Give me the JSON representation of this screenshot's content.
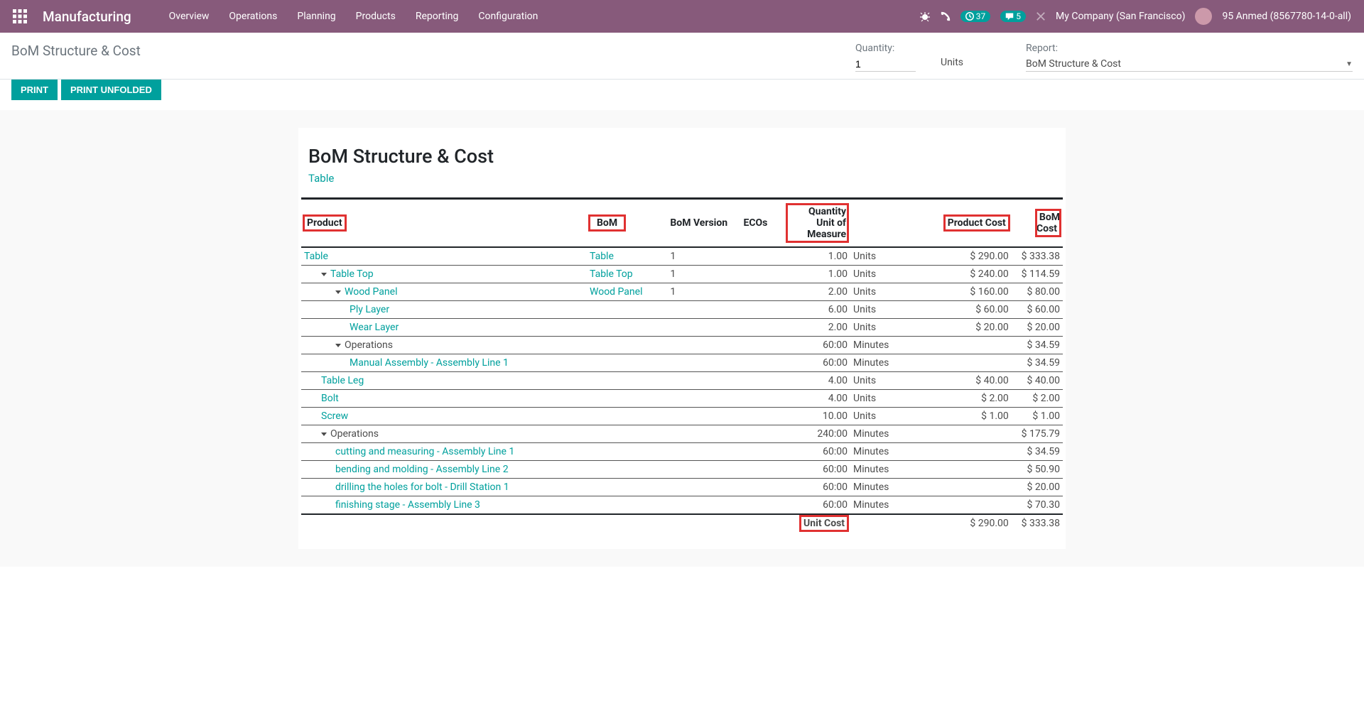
{
  "nav": {
    "brand": "Manufacturing",
    "menu": [
      "Overview",
      "Operations",
      "Planning",
      "Products",
      "Reporting",
      "Configuration"
    ],
    "activity_count": "37",
    "message_count": "5",
    "company": "My Company (San Francisco)",
    "user": "95 Anmed (8567780-14-0-all)"
  },
  "control": {
    "breadcrumb": "BoM Structure & Cost",
    "quantity_label": "Quantity:",
    "quantity_value": "1",
    "uom": "Units",
    "report_label": "Report:",
    "report_value": "BoM Structure & Cost"
  },
  "buttons": {
    "print": "PRINT",
    "print_unfolded": "PRINT UNFOLDED"
  },
  "report": {
    "title": "BoM Structure & Cost",
    "subtitle": "Table",
    "columns": {
      "product": "Product",
      "bom": "BoM",
      "bom_version": "BoM Version",
      "ecos": "ECOs",
      "quantity": "Quantity",
      "uom": "Unit of Measure",
      "product_cost": "Product Cost",
      "bom_cost": "BoM Cost"
    },
    "rows": [
      {
        "indent": 0,
        "caret": false,
        "product": "Table",
        "link": true,
        "bom": "Table",
        "bomver": "1",
        "ecos": "",
        "qty": "1.00",
        "uom": "Units",
        "pcost": "$ 290.00",
        "bcost": "$ 333.38"
      },
      {
        "indent": 1,
        "caret": true,
        "product": "Table Top",
        "link": true,
        "bom": "Table Top",
        "bomver": "1",
        "ecos": "",
        "qty": "1.00",
        "uom": "Units",
        "pcost": "$ 240.00",
        "bcost": "$ 114.59"
      },
      {
        "indent": 2,
        "caret": true,
        "product": "Wood Panel",
        "link": true,
        "bom": "Wood Panel",
        "bomver": "1",
        "ecos": "",
        "qty": "2.00",
        "uom": "Units",
        "pcost": "$ 160.00",
        "bcost": "$ 80.00"
      },
      {
        "indent": 3,
        "caret": false,
        "product": "Ply Layer",
        "link": true,
        "bom": "",
        "bomver": "",
        "ecos": "",
        "qty": "6.00",
        "uom": "Units",
        "pcost": "$ 60.00",
        "bcost": "$ 60.00"
      },
      {
        "indent": 3,
        "caret": false,
        "product": "Wear Layer",
        "link": true,
        "bom": "",
        "bomver": "",
        "ecos": "",
        "qty": "2.00",
        "uom": "Units",
        "pcost": "$ 20.00",
        "bcost": "$ 20.00"
      },
      {
        "indent": 2,
        "caret": true,
        "product": "Operations",
        "link": false,
        "bom": "",
        "bomver": "",
        "ecos": "",
        "qty": "60:00",
        "uom": "Minutes",
        "pcost": "",
        "bcost": "$ 34.59"
      },
      {
        "indent": 3,
        "caret": false,
        "product": "Manual Assembly - Assembly Line 1",
        "link": true,
        "bom": "",
        "bomver": "",
        "ecos": "",
        "qty": "60:00",
        "uom": "Minutes",
        "pcost": "",
        "bcost": "$ 34.59"
      },
      {
        "indent": 1,
        "caret": false,
        "product": "Table Leg",
        "link": true,
        "bom": "",
        "bomver": "",
        "ecos": "",
        "qty": "4.00",
        "uom": "Units",
        "pcost": "$ 40.00",
        "bcost": "$ 40.00"
      },
      {
        "indent": 1,
        "caret": false,
        "product": "Bolt",
        "link": true,
        "bom": "",
        "bomver": "",
        "ecos": "",
        "qty": "4.00",
        "uom": "Units",
        "pcost": "$ 2.00",
        "bcost": "$ 2.00"
      },
      {
        "indent": 1,
        "caret": false,
        "product": "Screw",
        "link": true,
        "bom": "",
        "bomver": "",
        "ecos": "",
        "qty": "10.00",
        "uom": "Units",
        "pcost": "$ 1.00",
        "bcost": "$ 1.00"
      },
      {
        "indent": 1,
        "caret": true,
        "product": "Operations",
        "link": false,
        "bom": "",
        "bomver": "",
        "ecos": "",
        "qty": "240:00",
        "uom": "Minutes",
        "pcost": "",
        "bcost": "$ 175.79"
      },
      {
        "indent": 2,
        "caret": false,
        "product": "cutting and measuring - Assembly Line 1",
        "link": true,
        "bom": "",
        "bomver": "",
        "ecos": "",
        "qty": "60:00",
        "uom": "Minutes",
        "pcost": "",
        "bcost": "$ 34.59"
      },
      {
        "indent": 2,
        "caret": false,
        "product": "bending and molding - Assembly Line 2",
        "link": true,
        "bom": "",
        "bomver": "",
        "ecos": "",
        "qty": "60:00",
        "uom": "Minutes",
        "pcost": "",
        "bcost": "$ 50.90"
      },
      {
        "indent": 2,
        "caret": false,
        "product": "drilling the holes for bolt - Drill Station 1",
        "link": true,
        "bom": "",
        "bomver": "",
        "ecos": "",
        "qty": "60:00",
        "uom": "Minutes",
        "pcost": "",
        "bcost": "$ 20.00"
      },
      {
        "indent": 2,
        "caret": false,
        "product": "finishing stage - Assembly Line 3",
        "link": true,
        "bom": "",
        "bomver": "",
        "ecos": "",
        "qty": "60:00",
        "uom": "Minutes",
        "pcost": "",
        "bcost": "$ 70.30"
      }
    ],
    "footer": {
      "label": "Unit Cost",
      "pcost": "$ 290.00",
      "bcost": "$ 333.38"
    }
  }
}
